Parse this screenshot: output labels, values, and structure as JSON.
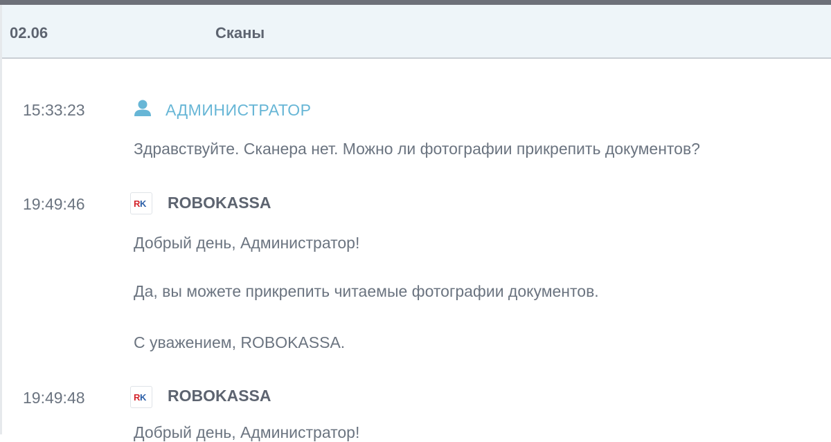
{
  "header": {
    "date": "02.06",
    "subject": "Сканы"
  },
  "messages": [
    {
      "time": "15:33:23",
      "author": "АДМИНИСТРАТОР",
      "author_icon": "user-icon",
      "lines": [
        "Здравствуйте. Сканера нет. Можно ли фотографии прикрепить документов?"
      ]
    },
    {
      "time": "19:49:46",
      "author": "ROBOKASSA",
      "author_icon": "robokassa-logo-icon",
      "lines": [
        "Добрый день, Администратор!",
        "Да, вы можете прикрепить читаемые фотографии документов.",
        "С уважением, ROBOKASSA."
      ]
    },
    {
      "time": "19:49:48",
      "author": "ROBOKASSA",
      "author_icon": "robokassa-logo-icon",
      "lines": [
        "Добрый день, Администратор!"
      ]
    }
  ],
  "colors": {
    "header_bg": "#eef5f9",
    "admin_accent": "#67b6d6",
    "logo_red": "#d3222a",
    "logo_blue": "#2b5ea7"
  }
}
